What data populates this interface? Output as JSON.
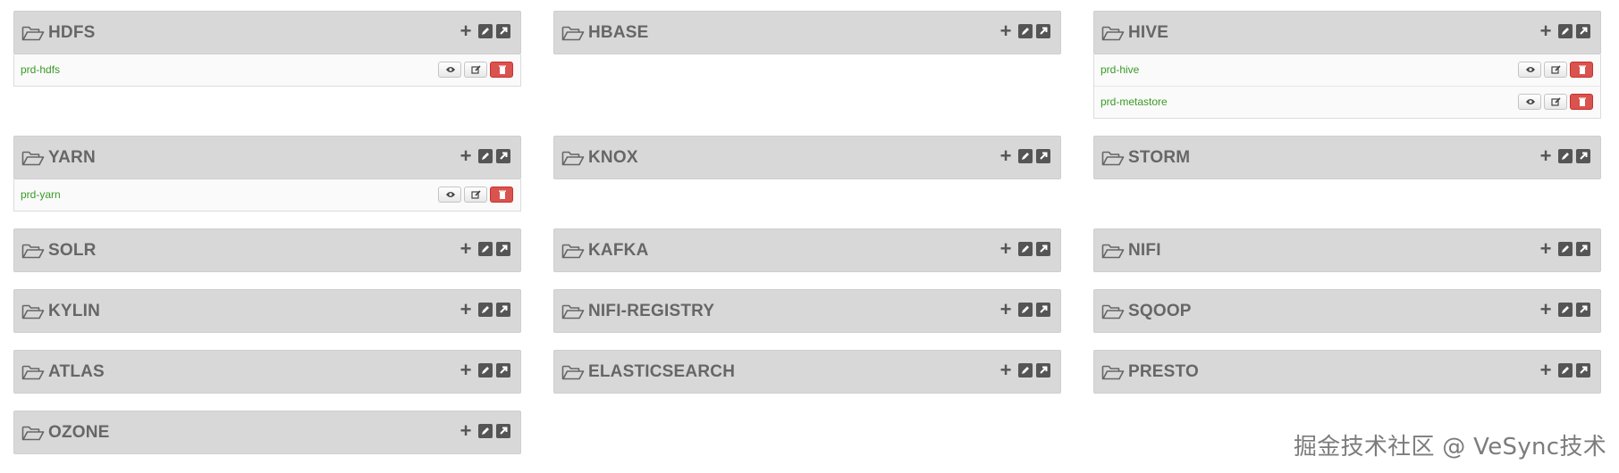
{
  "services": [
    {
      "id": "hdfs",
      "title": "HDFS",
      "instances": [
        "prd-hdfs"
      ]
    },
    {
      "id": "hbase",
      "title": "HBASE",
      "instances": []
    },
    {
      "id": "hive",
      "title": "HIVE",
      "instances": [
        "prd-hive",
        "prd-metastore"
      ]
    },
    {
      "id": "yarn",
      "title": "YARN",
      "instances": [
        "prd-yarn"
      ]
    },
    {
      "id": "knox",
      "title": "KNOX",
      "instances": []
    },
    {
      "id": "storm",
      "title": "STORM",
      "instances": []
    },
    {
      "id": "solr",
      "title": "SOLR",
      "instances": []
    },
    {
      "id": "kafka",
      "title": "KAFKA",
      "instances": []
    },
    {
      "id": "nifi",
      "title": "NIFI",
      "instances": []
    },
    {
      "id": "kylin",
      "title": "KYLIN",
      "instances": []
    },
    {
      "id": "nifi-registry",
      "title": "NIFI-REGISTRY",
      "instances": []
    },
    {
      "id": "sqoop",
      "title": "SQOOP",
      "instances": []
    },
    {
      "id": "atlas",
      "title": "ATLAS",
      "instances": []
    },
    {
      "id": "elasticsearch",
      "title": "ELASTICSEARCH",
      "instances": []
    },
    {
      "id": "presto",
      "title": "PRESTO",
      "instances": []
    },
    {
      "id": "ozone",
      "title": "OZONE",
      "instances": []
    }
  ],
  "icons": {
    "folder": "folder-open-icon",
    "add": "plus-icon",
    "edit": "edit-icon",
    "open": "external-link-icon",
    "view": "eye-icon",
    "row_edit": "pencil-icon",
    "delete": "trash-icon"
  },
  "colors": {
    "header_bg": "#d8d8d8",
    "title": "#666666",
    "service_link": "#3a9a26",
    "delete_btn": "#d9534f"
  },
  "watermark": "掘金技术社区 @ VeSync技术"
}
